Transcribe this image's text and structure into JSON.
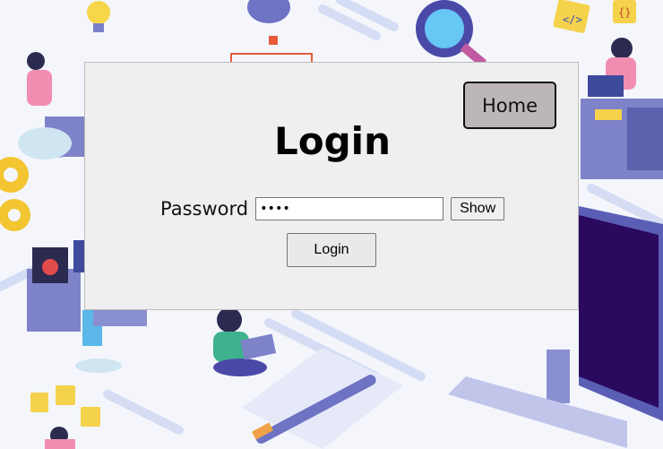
{
  "home": {
    "label": "Home"
  },
  "login_form": {
    "title": "Login",
    "password_label": "Password",
    "password_value": "••••",
    "show_label": "Show",
    "submit_label": "Login"
  },
  "background": {
    "card_labels": [
      "</>",
      "{}"
    ]
  },
  "colors": {
    "panel": "#efefef",
    "home_button": "#bcb6b6",
    "monitor": "#2a0a5e",
    "illustration_blue": "#6f73c4",
    "accent_orange": "#f0a24a"
  }
}
